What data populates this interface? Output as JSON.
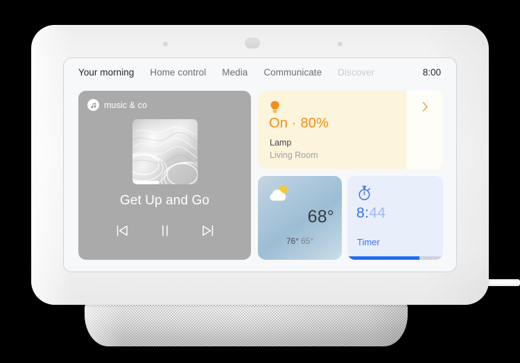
{
  "device": {
    "name": "smart-display",
    "sensors": [
      "ambient-light-sensor",
      "camera-sensor",
      "ambient-light-sensor-2"
    ]
  },
  "nav": {
    "items": [
      {
        "label": "Your morning",
        "state": "active"
      },
      {
        "label": "Home control",
        "state": "normal"
      },
      {
        "label": "Media",
        "state": "normal"
      },
      {
        "label": "Communicate",
        "state": "normal"
      },
      {
        "label": "Discover",
        "state": "dim"
      }
    ],
    "clock": "8:00"
  },
  "music_card": {
    "source": "music & co",
    "source_icon": "music-note-icon",
    "album_art": "water-ripple-artwork",
    "track_title": "Get Up and Go",
    "progress_percent": 40,
    "controls": [
      {
        "name": "previous-track-button",
        "icon": "skip-previous-icon"
      },
      {
        "name": "play-pause-button",
        "icon": "pause-icon"
      },
      {
        "name": "next-track-button",
        "icon": "skip-next-icon"
      }
    ]
  },
  "lamp_card": {
    "icon": "lightbulb-icon",
    "state": "On · 80%",
    "brightness_percent": 80,
    "device_name": "Lamp",
    "room": "Living Room",
    "chevron": "chevron-right-icon",
    "accent_color": "#f09018",
    "fill_color": "#fdf4dc"
  },
  "weather_card": {
    "icon": "partly-cloudy-icon",
    "temperature": "68°",
    "high": "76°",
    "low": "65°"
  },
  "timer_card": {
    "icon": "stopwatch-icon",
    "time_elapsed": "8:",
    "time_remaining": "44",
    "label": "Timer",
    "progress_percent": 75,
    "accent_color": "#1f6df0"
  }
}
